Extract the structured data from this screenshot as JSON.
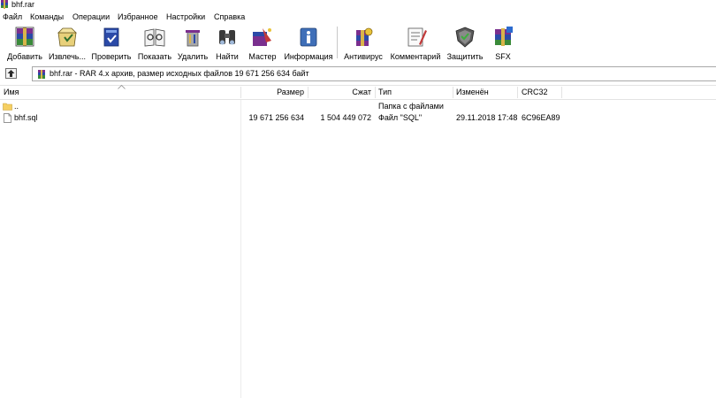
{
  "window": {
    "title": "bhf.rar"
  },
  "menu": [
    "Файл",
    "Команды",
    "Операции",
    "Избранное",
    "Настройки",
    "Справка"
  ],
  "toolbar": {
    "buttons": [
      {
        "label": "Добавить",
        "icon": "add-archive-icon"
      },
      {
        "label": "Извлечь...",
        "icon": "extract-icon"
      },
      {
        "label": "Проверить",
        "icon": "test-icon"
      },
      {
        "label": "Показать",
        "icon": "view-icon"
      },
      {
        "label": "Удалить",
        "icon": "delete-icon"
      },
      {
        "label": "Найти",
        "icon": "find-binoculars-icon"
      },
      {
        "label": "Мастер",
        "icon": "wizard-icon"
      },
      {
        "label": "Информация",
        "icon": "info-icon"
      },
      {
        "label": "Антивирус",
        "icon": "antivirus-icon"
      },
      {
        "label": "Комментарий",
        "icon": "comment-icon"
      },
      {
        "label": "Защитить",
        "icon": "protect-shield-icon"
      },
      {
        "label": "SFX",
        "icon": "sfx-icon"
      }
    ]
  },
  "address": {
    "text": "bhf.rar - RAR 4.x архив, размер исходных файлов 19 671 256 634 байт"
  },
  "columns": {
    "name": "Имя",
    "size": "Размер",
    "packed": "Сжат",
    "type": "Тип",
    "modified": "Изменён",
    "crc": "CRC32"
  },
  "files": [
    {
      "name": "..",
      "size": "",
      "packed": "",
      "type": "Папка с файлами",
      "modified": "",
      "crc": "",
      "icon": "folder-icon"
    },
    {
      "name": "bhf.sql",
      "size": "19 671 256 634",
      "packed": "1 504 449 072",
      "type": "Файл \"SQL\"",
      "modified": "29.11.2018 17:48",
      "crc": "6C96EA89",
      "icon": "file-icon"
    }
  ],
  "colors": {
    "folder": "#f5cf62",
    "rar_purple": "#7a2f8e",
    "rar_blue": "#2b4aa8"
  }
}
